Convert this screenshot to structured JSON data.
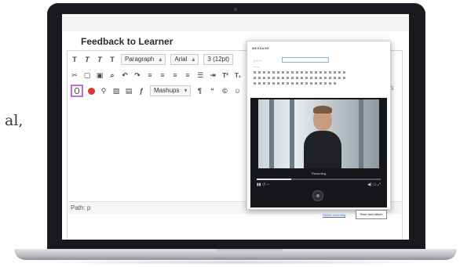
{
  "side_text": "al,",
  "screen": {
    "heading": "Feedback to Learner",
    "toolbar_row1": {
      "b1": "T",
      "b2": "T",
      "b3": "T",
      "b4": "T",
      "paragraph": "Paragraph",
      "font": "Arial",
      "size": "3 (12pt)",
      "sup": "T²",
      "sub": "T₁"
    },
    "toolbar_row3": {
      "mashups": "Mashups"
    },
    "path_label": "Path: p",
    "edge_text": "S"
  },
  "modal": {
    "title": "MESSAGE",
    "recording_label": "Recording",
    "delete_label": "Delete recording",
    "save_label": "Save and attach",
    "progress": 0.28
  },
  "colors": {
    "mic_highlight": "#c06ad8",
    "record_red": "#d43a2e"
  }
}
